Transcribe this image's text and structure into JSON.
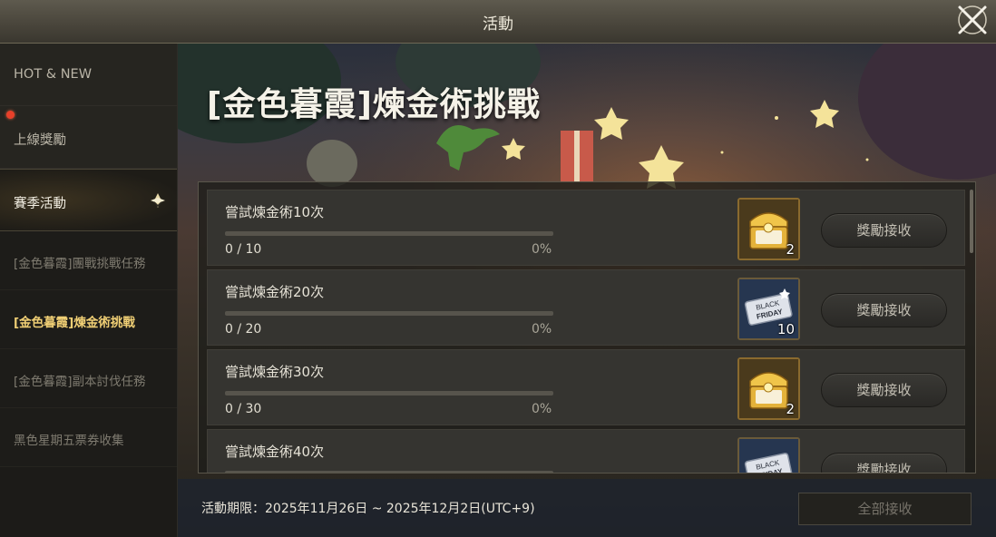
{
  "window": {
    "title": "活動"
  },
  "sidebar": {
    "items": [
      {
        "label": "HOT & NEW"
      },
      {
        "label": "上線獎勵"
      },
      {
        "label": "賽季活動"
      }
    ],
    "sub_items": [
      {
        "label": "[金色暮霞]團戰挑戰任務"
      },
      {
        "label": "[金色暮霞]煉金術挑戰"
      },
      {
        "label": "[金色暮霞]副本討伐任務"
      },
      {
        "label": "黑色星期五票券收集"
      }
    ]
  },
  "event": {
    "title": "[金色暮霞]煉金術挑戰",
    "period": "活動期限：2025年11月26日 ~ 2025年12月2日(UTC+9)",
    "claim_all_label": "全部接收"
  },
  "quests": [
    {
      "name": "嘗試煉金術10次",
      "progress": "0 / 10",
      "percent": "0%",
      "reward_icon": "golden-chest-icon",
      "reward_qty": "2",
      "claim_label": "獎勵接收"
    },
    {
      "name": "嘗試煉金術20次",
      "progress": "0 / 20",
      "percent": "0%",
      "reward_icon": "black-friday-ticket-icon",
      "reward_qty": "10",
      "claim_label": "獎勵接收"
    },
    {
      "name": "嘗試煉金術30次",
      "progress": "0 / 30",
      "percent": "0%",
      "reward_icon": "golden-chest-icon",
      "reward_qty": "2",
      "claim_label": "獎勵接收"
    },
    {
      "name": "嘗試煉金術40次",
      "progress": "",
      "percent": "",
      "reward_icon": "black-friday-ticket-icon",
      "reward_qty": "",
      "claim_label": "獎勵接收"
    }
  ],
  "ticket_text": {
    "line1": "BLACK",
    "line2": "FRIDAY"
  },
  "colors": {
    "accent_gold": "#f0cf75",
    "notification_red": "#e8402a"
  }
}
